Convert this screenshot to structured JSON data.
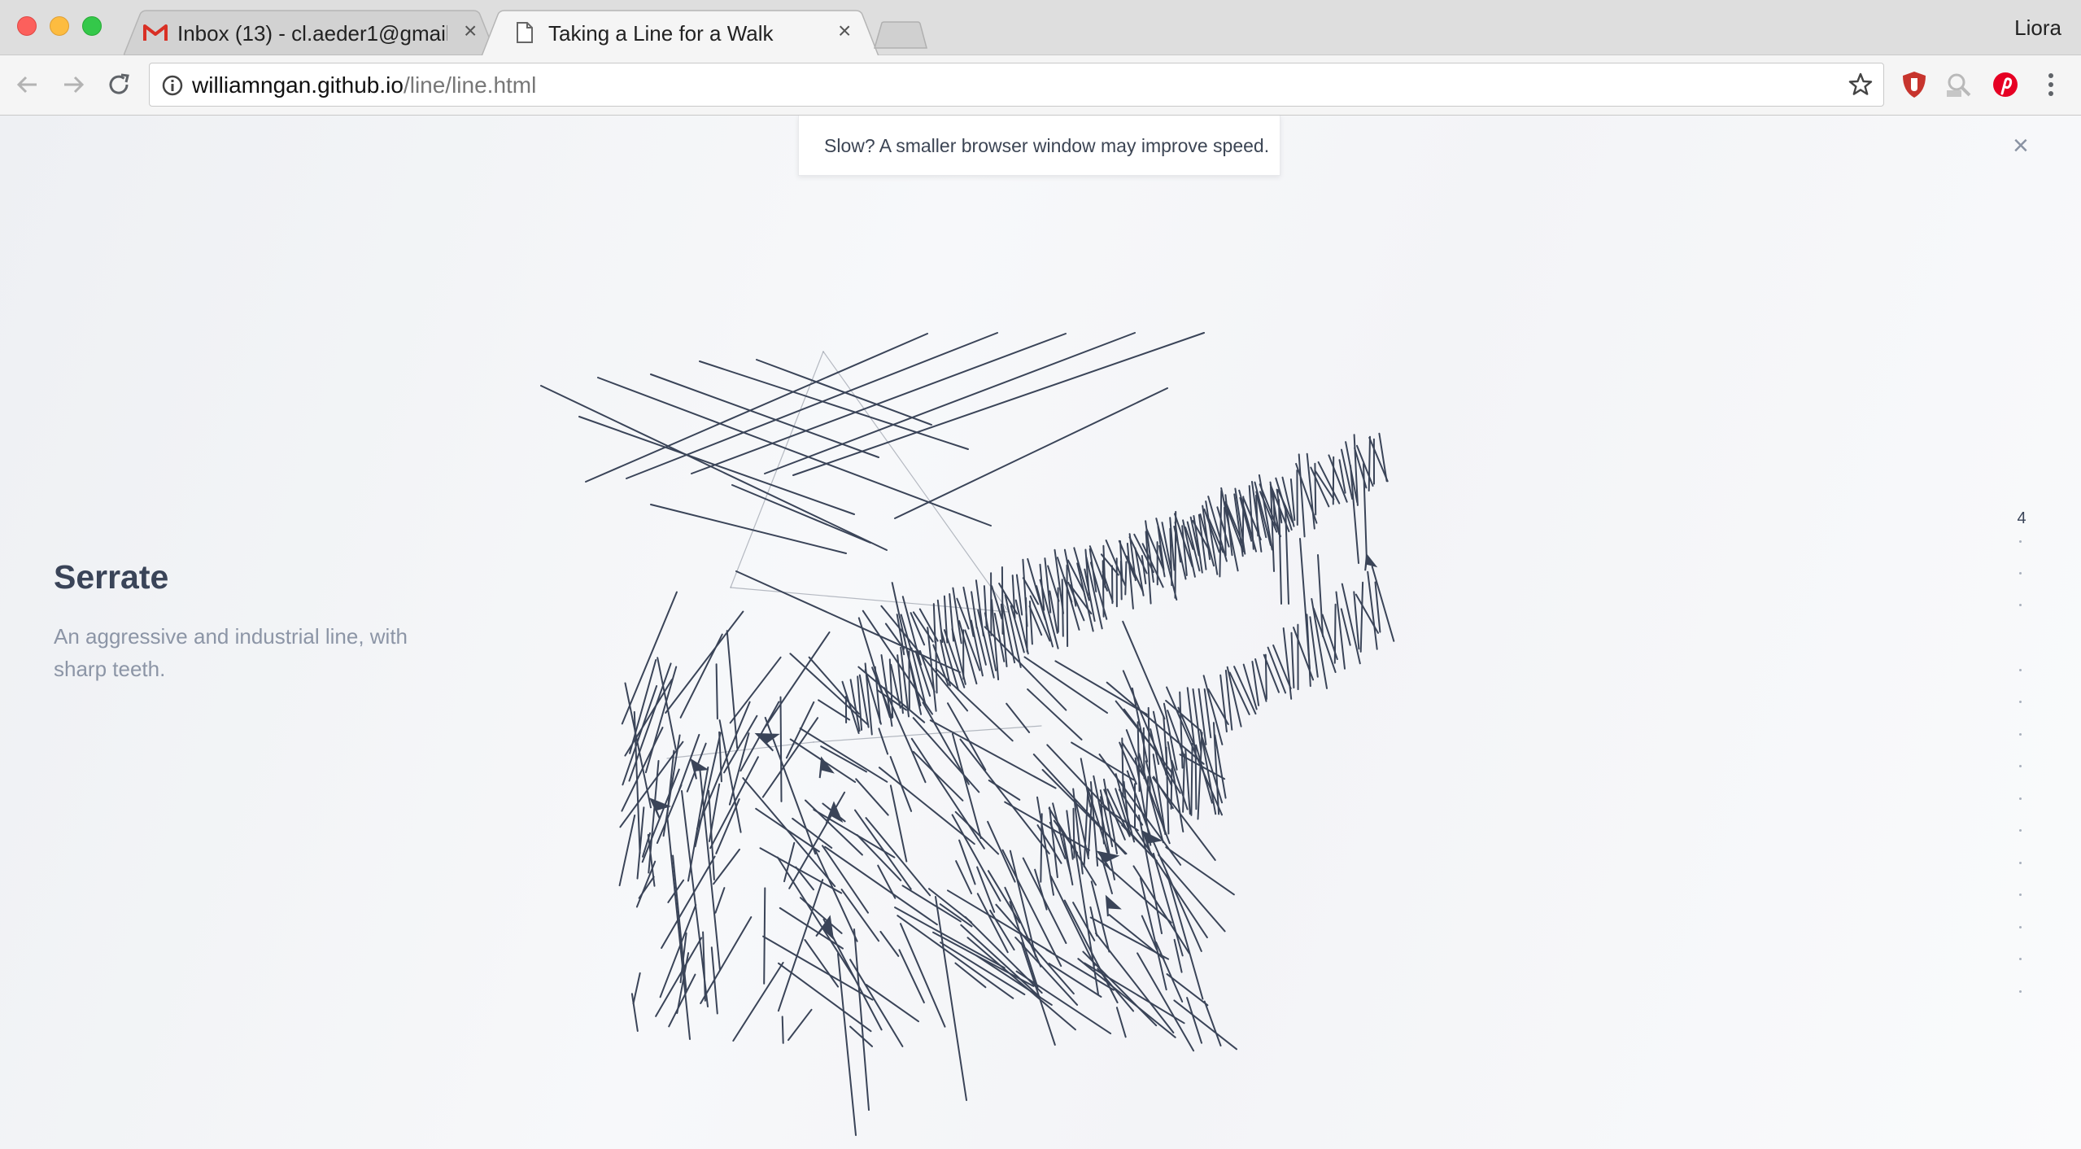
{
  "browser": {
    "tabs": [
      {
        "title": "Inbox (13) - cl.aeder1@gmail.com",
        "icon": "gmail-icon",
        "active": false
      },
      {
        "title": "Taking a Line for a Walk",
        "icon": "page-icon",
        "active": true
      }
    ],
    "profile_name": "Liora",
    "url_host": "williamngan.github.io",
    "url_path": "/line/line.html"
  },
  "page": {
    "notice": "Slow? A smaller browser window may improve speed.",
    "line_name": "Serrate",
    "line_description": "An aggressive and industrial line, with sharp teeth.",
    "pager": {
      "current": "4"
    }
  },
  "colors": {
    "ink": "#3a4458",
    "muted_text": "#8c95a6",
    "gmail_red": "#d93025",
    "pinterest_red": "#e60023"
  }
}
